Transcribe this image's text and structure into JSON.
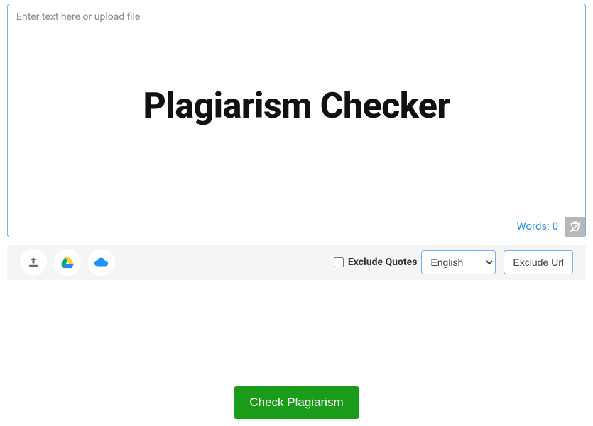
{
  "input": {
    "placeholder": "Enter text here or upload file",
    "value": ""
  },
  "heading": "Plagiarism Checker",
  "words": {
    "label": "Words:",
    "count": "0"
  },
  "toolbar": {
    "exclude_quotes_label": "Exclude Quotes",
    "language_selected": "English",
    "exclude_url_label": "Exclude Url"
  },
  "action": {
    "check_label": "Check Plagiarism"
  }
}
